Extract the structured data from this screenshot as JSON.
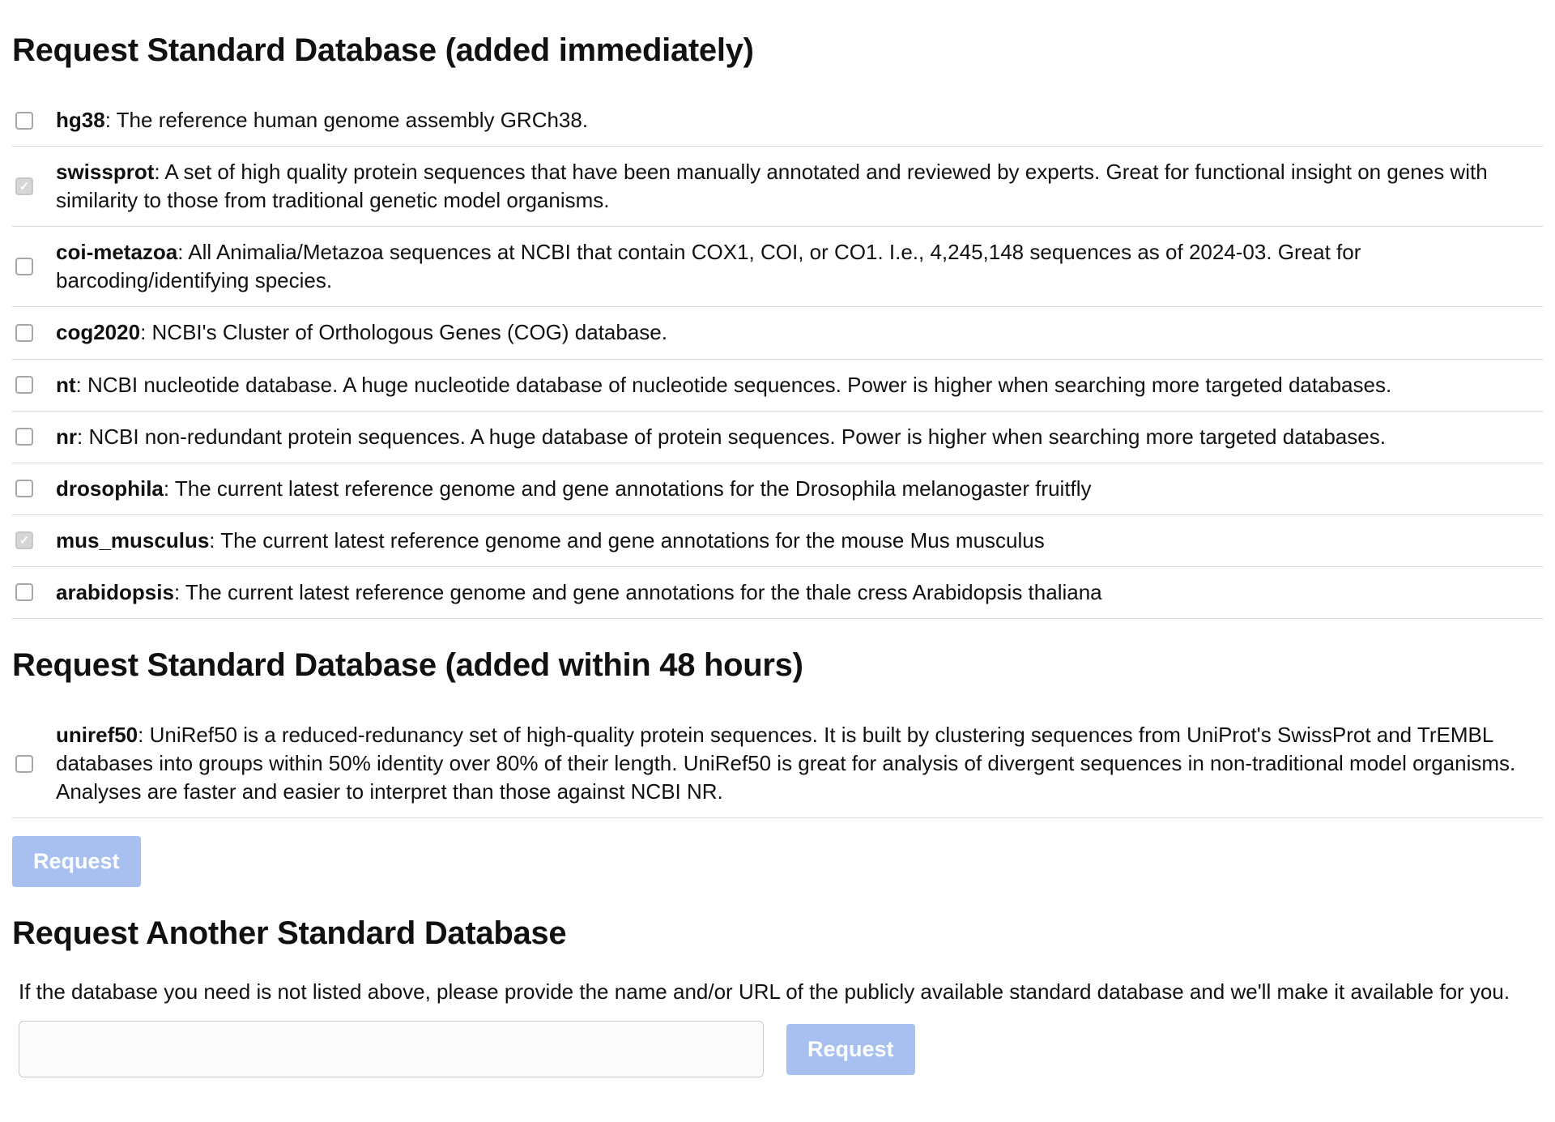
{
  "section_immediate": {
    "heading": "Request Standard Database (added immediately)",
    "items": [
      {
        "name": "hg38",
        "desc": ": The reference human genome assembly GRCh38.",
        "checked": false
      },
      {
        "name": "swissprot",
        "desc": ": A set of high quality protein sequences that have been manually annotated and reviewed by experts. Great for functional insight on genes with similarity to those from traditional genetic model organisms.",
        "checked": true
      },
      {
        "name": "coi-metazoa",
        "desc": ": All Animalia/Metazoa sequences at NCBI that contain COX1, COI, or CO1. I.e., 4,245,148 sequences as of 2024-03. Great for barcoding/identifying species.",
        "checked": false
      },
      {
        "name": "cog2020",
        "desc": ": NCBI's Cluster of Orthologous Genes (COG) database.",
        "checked": false
      },
      {
        "name": "nt",
        "desc": ": NCBI nucleotide database. A huge nucleotide database of nucleotide sequences. Power is higher when searching more targeted databases.",
        "checked": false
      },
      {
        "name": "nr",
        "desc": ": NCBI non-redundant protein sequences. A huge database of protein sequences. Power is higher when searching more targeted databases.",
        "checked": false
      },
      {
        "name": "drosophila",
        "desc": ": The current latest reference genome and gene annotations for the Drosophila melanogaster fruitfly",
        "checked": false
      },
      {
        "name": "mus_musculus",
        "desc": ": The current latest reference genome and gene annotations for the mouse Mus musculus",
        "checked": true
      },
      {
        "name": "arabidopsis",
        "desc": ": The current latest reference genome and gene annotations for the thale cress Arabidopsis thaliana",
        "checked": false
      }
    ]
  },
  "section_48h": {
    "heading": "Request Standard Database (added within 48 hours)",
    "items": [
      {
        "name": "uniref50",
        "desc": ": UniRef50 is a reduced-redunancy set of high-quality protein sequences. It is built by clustering sequences from UniProt's SwissProt and TrEMBL databases into groups within 50% identity over 80% of their length. UniRef50 is great for analysis of divergent sequences in non-traditional model organisms. Analyses are faster and easier to interpret than those against NCBI NR.",
        "checked": false
      }
    ]
  },
  "buttons": {
    "request": "Request",
    "request_other": "Request"
  },
  "section_other": {
    "heading": "Request Another Standard Database",
    "note": "If the database you need is not listed above, please provide the name and/or URL of the publicly available standard database and we'll make it available for you.",
    "input_value": ""
  }
}
